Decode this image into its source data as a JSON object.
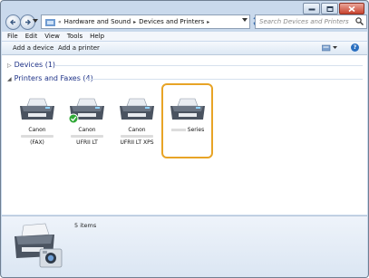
{
  "window": {
    "caption": {
      "minimize": "minimize",
      "maximize": "maximize",
      "close": "close"
    }
  },
  "address": {
    "crumbs": [
      "Hardware and Sound",
      "Devices and Printers"
    ],
    "chevron": "«"
  },
  "search": {
    "placeholder": "Search Devices and Printers"
  },
  "menu": [
    "File",
    "Edit",
    "View",
    "Tools",
    "Help"
  ],
  "commands": {
    "add_device": "Add a device",
    "add_printer": "Add a printer"
  },
  "groups": {
    "devices": "Devices (1)",
    "printers": "Printers and Faxes (4)"
  },
  "printers": [
    {
      "name": "Canon",
      "model": "(FAX)",
      "default": false
    },
    {
      "name": "Canon",
      "model": "UFRII LT",
      "default": true
    },
    {
      "name": "Canon",
      "model": "UFRII LT XPS",
      "default": false
    },
    {
      "name": "",
      "model": "Series",
      "default": false
    }
  ],
  "details": {
    "count": "5 items"
  },
  "colors": {
    "selection": "#e8a426",
    "group_header": "#1e3287",
    "default_check": "#2fa836"
  }
}
